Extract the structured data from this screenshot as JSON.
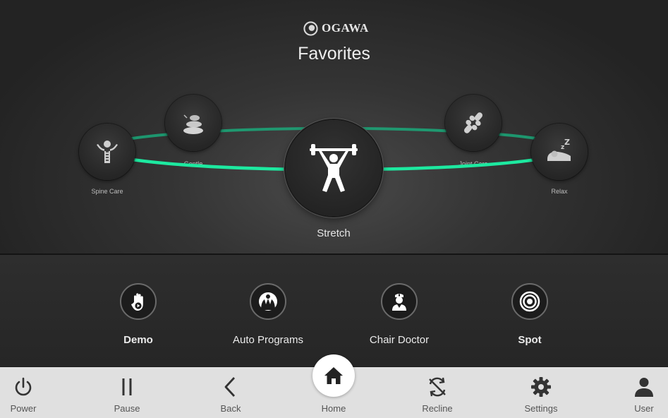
{
  "brand": {
    "logo_text": "OGAWA"
  },
  "favorites": {
    "title": "Favorites",
    "selected": {
      "label": "Stretch",
      "icon": "weightlifter-icon"
    },
    "ring_color": "#1de9a0",
    "items": [
      {
        "label": "Spine Care",
        "icon": "spine-care-icon"
      },
      {
        "label": "Gentle",
        "icon": "stones-icon"
      },
      {
        "label": "Joint Care",
        "icon": "joint-icon"
      },
      {
        "label": "Relax",
        "icon": "sleep-icon"
      }
    ]
  },
  "shortcuts": [
    {
      "label": "Demo",
      "icon": "hand-play-icon"
    },
    {
      "label": "Auto Programs",
      "icon": "auto-program-icon"
    },
    {
      "label": "Chair Doctor",
      "icon": "doctor-icon"
    },
    {
      "label": "Spot",
      "icon": "target-icon"
    }
  ],
  "nav": [
    {
      "label": "Power",
      "icon": "power-icon"
    },
    {
      "label": "Pause",
      "icon": "pause-icon"
    },
    {
      "label": "Back",
      "icon": "back-icon"
    },
    {
      "label": "Home",
      "icon": "home-icon",
      "active": true
    },
    {
      "label": "Recline",
      "icon": "recline-icon"
    },
    {
      "label": "Settings",
      "icon": "gear-icon"
    },
    {
      "label": "User",
      "icon": "user-icon"
    }
  ]
}
